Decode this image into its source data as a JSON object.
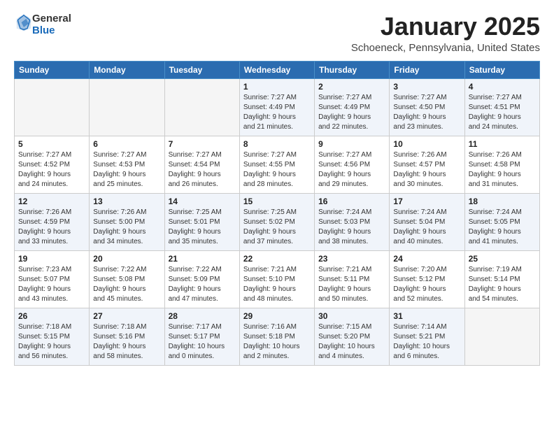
{
  "logo": {
    "general": "General",
    "blue": "Blue"
  },
  "title": "January 2025",
  "location": "Schoeneck, Pennsylvania, United States",
  "headers": [
    "Sunday",
    "Monday",
    "Tuesday",
    "Wednesday",
    "Thursday",
    "Friday",
    "Saturday"
  ],
  "weeks": [
    [
      {
        "num": "",
        "info": ""
      },
      {
        "num": "",
        "info": ""
      },
      {
        "num": "",
        "info": ""
      },
      {
        "num": "1",
        "info": "Sunrise: 7:27 AM\nSunset: 4:49 PM\nDaylight: 9 hours\nand 21 minutes."
      },
      {
        "num": "2",
        "info": "Sunrise: 7:27 AM\nSunset: 4:49 PM\nDaylight: 9 hours\nand 22 minutes."
      },
      {
        "num": "3",
        "info": "Sunrise: 7:27 AM\nSunset: 4:50 PM\nDaylight: 9 hours\nand 23 minutes."
      },
      {
        "num": "4",
        "info": "Sunrise: 7:27 AM\nSunset: 4:51 PM\nDaylight: 9 hours\nand 24 minutes."
      }
    ],
    [
      {
        "num": "5",
        "info": "Sunrise: 7:27 AM\nSunset: 4:52 PM\nDaylight: 9 hours\nand 24 minutes."
      },
      {
        "num": "6",
        "info": "Sunrise: 7:27 AM\nSunset: 4:53 PM\nDaylight: 9 hours\nand 25 minutes."
      },
      {
        "num": "7",
        "info": "Sunrise: 7:27 AM\nSunset: 4:54 PM\nDaylight: 9 hours\nand 26 minutes."
      },
      {
        "num": "8",
        "info": "Sunrise: 7:27 AM\nSunset: 4:55 PM\nDaylight: 9 hours\nand 28 minutes."
      },
      {
        "num": "9",
        "info": "Sunrise: 7:27 AM\nSunset: 4:56 PM\nDaylight: 9 hours\nand 29 minutes."
      },
      {
        "num": "10",
        "info": "Sunrise: 7:26 AM\nSunset: 4:57 PM\nDaylight: 9 hours\nand 30 minutes."
      },
      {
        "num": "11",
        "info": "Sunrise: 7:26 AM\nSunset: 4:58 PM\nDaylight: 9 hours\nand 31 minutes."
      }
    ],
    [
      {
        "num": "12",
        "info": "Sunrise: 7:26 AM\nSunset: 4:59 PM\nDaylight: 9 hours\nand 33 minutes."
      },
      {
        "num": "13",
        "info": "Sunrise: 7:26 AM\nSunset: 5:00 PM\nDaylight: 9 hours\nand 34 minutes."
      },
      {
        "num": "14",
        "info": "Sunrise: 7:25 AM\nSunset: 5:01 PM\nDaylight: 9 hours\nand 35 minutes."
      },
      {
        "num": "15",
        "info": "Sunrise: 7:25 AM\nSunset: 5:02 PM\nDaylight: 9 hours\nand 37 minutes."
      },
      {
        "num": "16",
        "info": "Sunrise: 7:24 AM\nSunset: 5:03 PM\nDaylight: 9 hours\nand 38 minutes."
      },
      {
        "num": "17",
        "info": "Sunrise: 7:24 AM\nSunset: 5:04 PM\nDaylight: 9 hours\nand 40 minutes."
      },
      {
        "num": "18",
        "info": "Sunrise: 7:24 AM\nSunset: 5:05 PM\nDaylight: 9 hours\nand 41 minutes."
      }
    ],
    [
      {
        "num": "19",
        "info": "Sunrise: 7:23 AM\nSunset: 5:07 PM\nDaylight: 9 hours\nand 43 minutes."
      },
      {
        "num": "20",
        "info": "Sunrise: 7:22 AM\nSunset: 5:08 PM\nDaylight: 9 hours\nand 45 minutes."
      },
      {
        "num": "21",
        "info": "Sunrise: 7:22 AM\nSunset: 5:09 PM\nDaylight: 9 hours\nand 47 minutes."
      },
      {
        "num": "22",
        "info": "Sunrise: 7:21 AM\nSunset: 5:10 PM\nDaylight: 9 hours\nand 48 minutes."
      },
      {
        "num": "23",
        "info": "Sunrise: 7:21 AM\nSunset: 5:11 PM\nDaylight: 9 hours\nand 50 minutes."
      },
      {
        "num": "24",
        "info": "Sunrise: 7:20 AM\nSunset: 5:12 PM\nDaylight: 9 hours\nand 52 minutes."
      },
      {
        "num": "25",
        "info": "Sunrise: 7:19 AM\nSunset: 5:14 PM\nDaylight: 9 hours\nand 54 minutes."
      }
    ],
    [
      {
        "num": "26",
        "info": "Sunrise: 7:18 AM\nSunset: 5:15 PM\nDaylight: 9 hours\nand 56 minutes."
      },
      {
        "num": "27",
        "info": "Sunrise: 7:18 AM\nSunset: 5:16 PM\nDaylight: 9 hours\nand 58 minutes."
      },
      {
        "num": "28",
        "info": "Sunrise: 7:17 AM\nSunset: 5:17 PM\nDaylight: 10 hours\nand 0 minutes."
      },
      {
        "num": "29",
        "info": "Sunrise: 7:16 AM\nSunset: 5:18 PM\nDaylight: 10 hours\nand 2 minutes."
      },
      {
        "num": "30",
        "info": "Sunrise: 7:15 AM\nSunset: 5:20 PM\nDaylight: 10 hours\nand 4 minutes."
      },
      {
        "num": "31",
        "info": "Sunrise: 7:14 AM\nSunset: 5:21 PM\nDaylight: 10 hours\nand 6 minutes."
      },
      {
        "num": "",
        "info": ""
      }
    ]
  ]
}
